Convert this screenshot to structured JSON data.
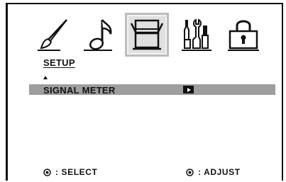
{
  "menu_icons": [
    {
      "icon": "paint-brush-icon",
      "active": false
    },
    {
      "icon": "music-note-icon",
      "active": false
    },
    {
      "icon": "setup-screen-icon",
      "active": true
    },
    {
      "icon": "tools-icon",
      "active": false
    },
    {
      "icon": "lock-icon",
      "active": false
    }
  ],
  "section": {
    "title": "SETUP"
  },
  "menu": {
    "items": [
      {
        "label": "SIGNAL METER",
        "selected": true
      }
    ]
  },
  "footer": {
    "select_label": ": SELECT",
    "adjust_label": ": ADJUST"
  },
  "colors": {
    "highlight": "#9e9e9e",
    "active_icon_bg": "#e0e0e0",
    "text": "#111111"
  }
}
